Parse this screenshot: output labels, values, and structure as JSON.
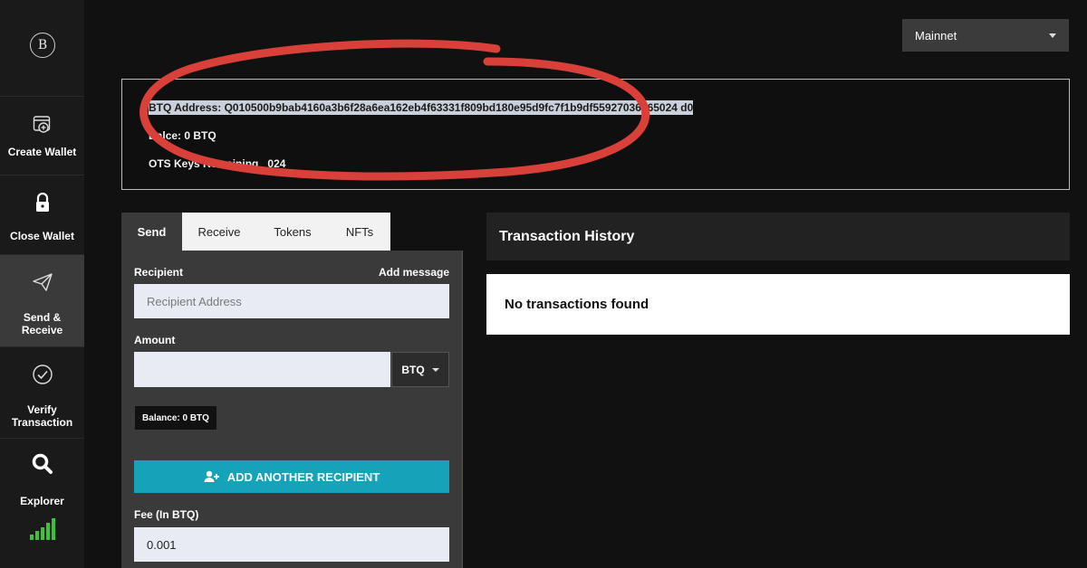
{
  "sidebar": {
    "logo_glyph": "B",
    "items": [
      {
        "label": "Create Wallet",
        "icon": "create-wallet-icon"
      },
      {
        "label": "Close Wallet",
        "icon": "lock-icon"
      },
      {
        "label": "Send & Receive",
        "icon": "paper-plane-icon"
      },
      {
        "label": "Verify Transaction",
        "icon": "check-circle-icon"
      },
      {
        "label": "Explorer",
        "icon": "search-icon"
      }
    ],
    "status_icon": "signal-bars-icon"
  },
  "network": {
    "selected": "Mainnet"
  },
  "wallet": {
    "address_label": "BTQ Address:",
    "address": "Q010500b9bab4160a3b6f28a6ea162eb4f63331f809bd180e95d9fc7f1b9df55927036865024",
    "address_end": "d0",
    "balance_label": "Bal",
    "balance_rest": "ce: 0 BTQ",
    "ots_label": "OTS Keys Remaining",
    "ots_value": "024"
  },
  "send_panel": {
    "tabs": [
      "Send",
      "Receive",
      "Tokens",
      "NFTs"
    ],
    "recipient_label": "Recipient",
    "add_message_link": "Add message",
    "recipient_placeholder": "Recipient Address",
    "amount_label": "Amount",
    "amount_value": "",
    "unit": "BTQ",
    "balance_badge": "Balance: 0 BTQ",
    "add_recipient_button": "ADD ANOTHER RECIPIENT",
    "fee_label": "Fee (In BTQ)",
    "fee_value": "0.001"
  },
  "history": {
    "title": "Transaction History",
    "empty_text": "No transactions found"
  },
  "colors": {
    "accent": "#16a2b8",
    "annotation": "#d9403a",
    "signal": "#39c43a"
  }
}
